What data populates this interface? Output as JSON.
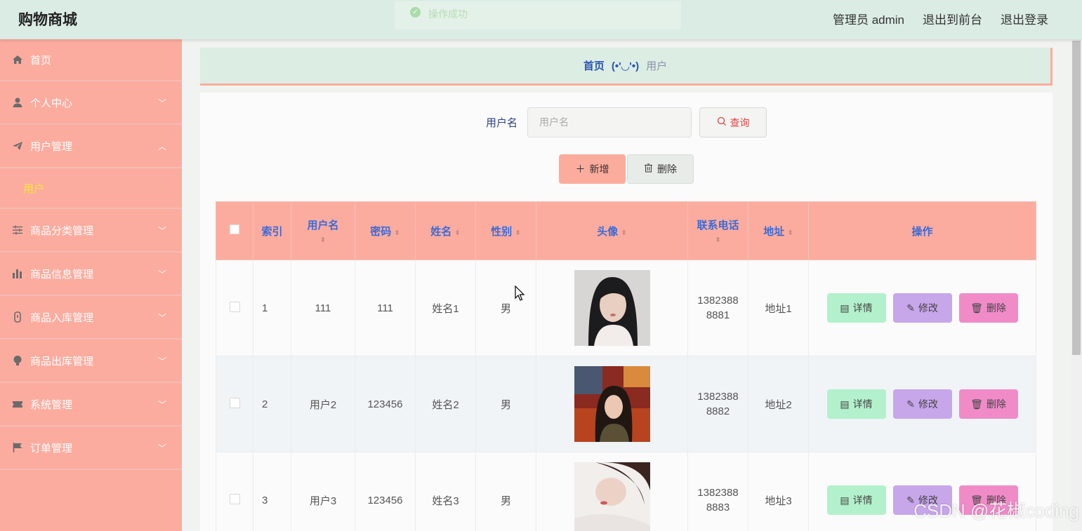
{
  "header": {
    "brand": "购物商城",
    "toast": "操作成功",
    "admin": "管理员 admin",
    "front": "退出到前台",
    "logout": "退出登录"
  },
  "sidebar": {
    "items": [
      {
        "label": "首页",
        "icon": "home-icon"
      },
      {
        "label": "个人中心",
        "icon": "user-icon"
      },
      {
        "label": "用户管理",
        "icon": "paper-plane-icon",
        "expanded": true
      },
      {
        "label": "商品分类管理",
        "icon": "sliders-icon"
      },
      {
        "label": "商品信息管理",
        "icon": "bar-chart-icon"
      },
      {
        "label": "商品入库管理",
        "icon": "stopwatch-icon"
      },
      {
        "label": "商品出库管理",
        "icon": "bulb-icon"
      },
      {
        "label": "系统管理",
        "icon": "ticket-icon"
      },
      {
        "label": "订单管理",
        "icon": "flag-icon"
      }
    ],
    "sub_active": "用户"
  },
  "breadcrumb": {
    "home": "首页",
    "face": "(•'◡'•)",
    "current": "用户"
  },
  "search": {
    "label": "用户名",
    "placeholder": "用户名",
    "button": "查询"
  },
  "actions": {
    "add": "新增",
    "delete": "删除"
  },
  "table": {
    "headers": [
      "索引",
      "用户名",
      "密码",
      "姓名",
      "性别",
      "头像",
      "联系电话",
      "地址",
      "操作"
    ],
    "rows": [
      {
        "index": "1",
        "username": "111",
        "password": "111",
        "name": "姓名1",
        "gender": "男",
        "phone1": "1382388",
        "phone2": "8881",
        "address": "地址1"
      },
      {
        "index": "2",
        "username": "用户2",
        "password": "123456",
        "name": "姓名2",
        "gender": "男",
        "phone1": "1382388",
        "phone2": "8882",
        "address": "地址2"
      },
      {
        "index": "3",
        "username": "用户3",
        "password": "123456",
        "name": "姓名3",
        "gender": "男",
        "phone1": "1382388",
        "phone2": "8883",
        "address": "地址3"
      }
    ],
    "ops": {
      "detail": "详情",
      "edit": "修改",
      "remove": "删除"
    }
  },
  "watermark": "CSDN @花椒coding",
  "colors": {
    "header_bg": "#dbece5",
    "sidebar_bg": "#fcac9f",
    "table_header_bg": "#fcac9f",
    "detail_btn": "#b2f1cc",
    "edit_btn": "#c8a6ea",
    "delete_btn": "#f08bc8",
    "submenu_active": "#f5e53c"
  }
}
